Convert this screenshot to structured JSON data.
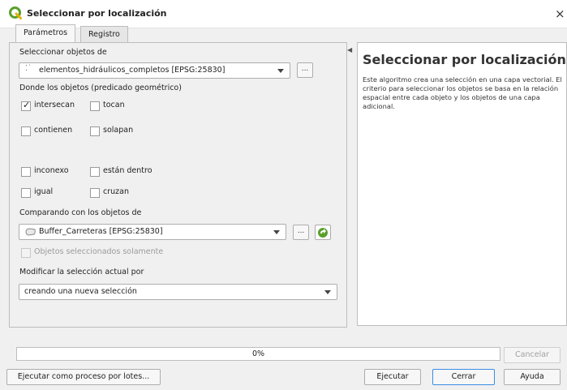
{
  "window": {
    "title": "Seleccionar por localización",
    "close_glyph": "×",
    "app_icon": "qgis-icon"
  },
  "tabs": [
    {
      "label": "Parámetros",
      "active": true
    },
    {
      "label": "Registro",
      "active": false
    }
  ],
  "params": {
    "input_label": "Seleccionar objetos de",
    "input_layer": "elementos_hidráulicos_completos [EPSG:25830]",
    "predicate_label": "Donde los objetos (predicado geométrico)",
    "predicates": [
      {
        "label": "intersecan",
        "checked": true
      },
      {
        "label": "tocan",
        "checked": false
      },
      {
        "label": "contienen",
        "checked": false
      },
      {
        "label": "solapan",
        "checked": false
      },
      {
        "label": "inconexo",
        "checked": false
      },
      {
        "label": "están dentro",
        "checked": false
      },
      {
        "label": "igual",
        "checked": false
      },
      {
        "label": "cruzan",
        "checked": false
      }
    ],
    "intersect_label": "Comparando con los objetos de",
    "intersect_layer": "Buffer_Carreteras [EPSG:25830]",
    "selected_only_label": "Objetos seleccionados solamente",
    "method_label": "Modificar la selección actual por",
    "method_value": "creando una nueva selección",
    "browse_glyph": "..."
  },
  "help": {
    "title": "Seleccionar por localización",
    "body": "Este algoritmo crea una selección en una capa vectorial. El criterio para seleccionar los objetos se basa en la relación espacial entre cada objeto y los objetos de una capa adicional."
  },
  "progress": {
    "value": 0,
    "label": "0%"
  },
  "buttons": {
    "batch": "Ejecutar como proceso por lotes...",
    "cancel": "Cancelar",
    "run": "Ejecutar",
    "close": "Cerrar",
    "help": "Ayuda"
  },
  "colors": {
    "accent": "#3a8ee6",
    "qgis_green": "#5aa02c",
    "panel_bg": "#f0f0f0"
  }
}
